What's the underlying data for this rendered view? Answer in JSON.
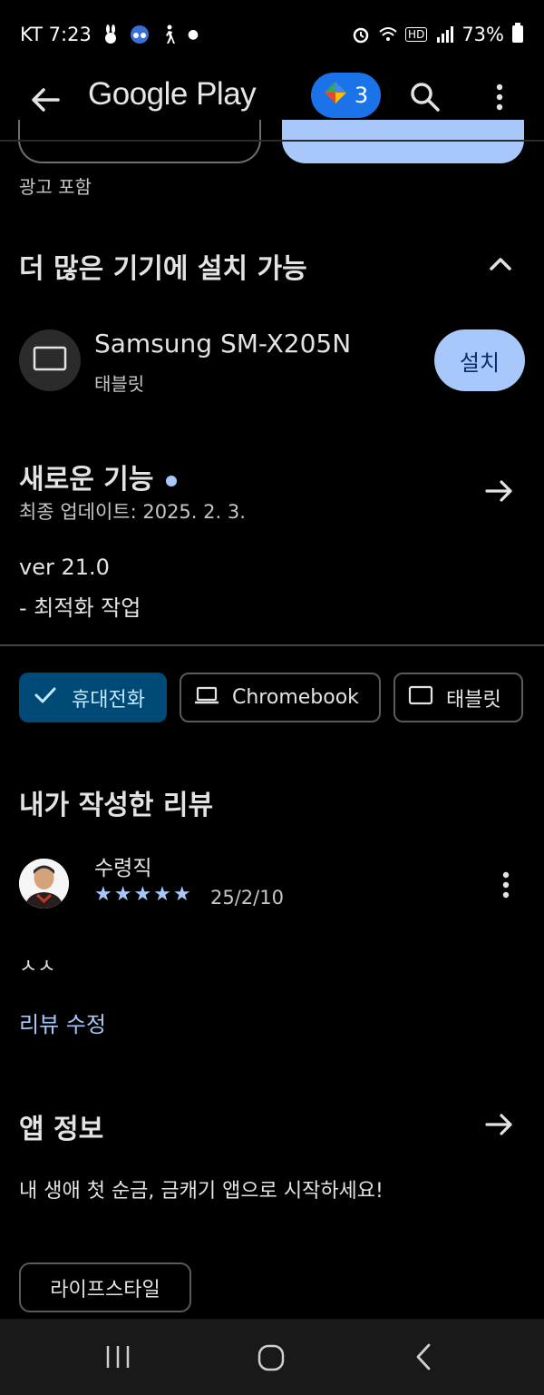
{
  "status_bar": {
    "carrier_time": "KT 7:23",
    "battery": "73%"
  },
  "app_bar": {
    "logo": "Google Play",
    "rewards_count": "3"
  },
  "ad_label": "광고 포함",
  "devices_section": {
    "title": "더 많은 기기에 설치 가능",
    "device_name": "Samsung SM-X205N",
    "device_type": "태블릿",
    "install_label": "설치"
  },
  "whats_new": {
    "title": "새로운 기능",
    "last_updated": "최종 업데이트: 2025. 2. 3.",
    "version": "ver 21.0",
    "note": "- 최적화 작업"
  },
  "device_chips": [
    {
      "label": "휴대전화",
      "icon": "check-icon",
      "selected": true
    },
    {
      "label": "Chromebook",
      "icon": "laptop-icon",
      "selected": false
    },
    {
      "label": "태블릿",
      "icon": "tablet-icon",
      "selected": false
    }
  ],
  "my_review": {
    "title": "내가 작성한 리뷰",
    "author": "수령직",
    "rating": 5,
    "stars": "★★★★★",
    "date": "25/2/10",
    "text": "ㅅㅅ",
    "edit_label": "리뷰 수정"
  },
  "app_info": {
    "title": "앱 정보",
    "description": "내 생애 첫 순금, 금캐기 앱으로 시작하세요!",
    "category_tag": "라이프스타일"
  },
  "colors": {
    "background": "#000000",
    "accent": "#a8c7fa",
    "chip_selected": "#004a77",
    "play_blue": "#1a73e8"
  }
}
